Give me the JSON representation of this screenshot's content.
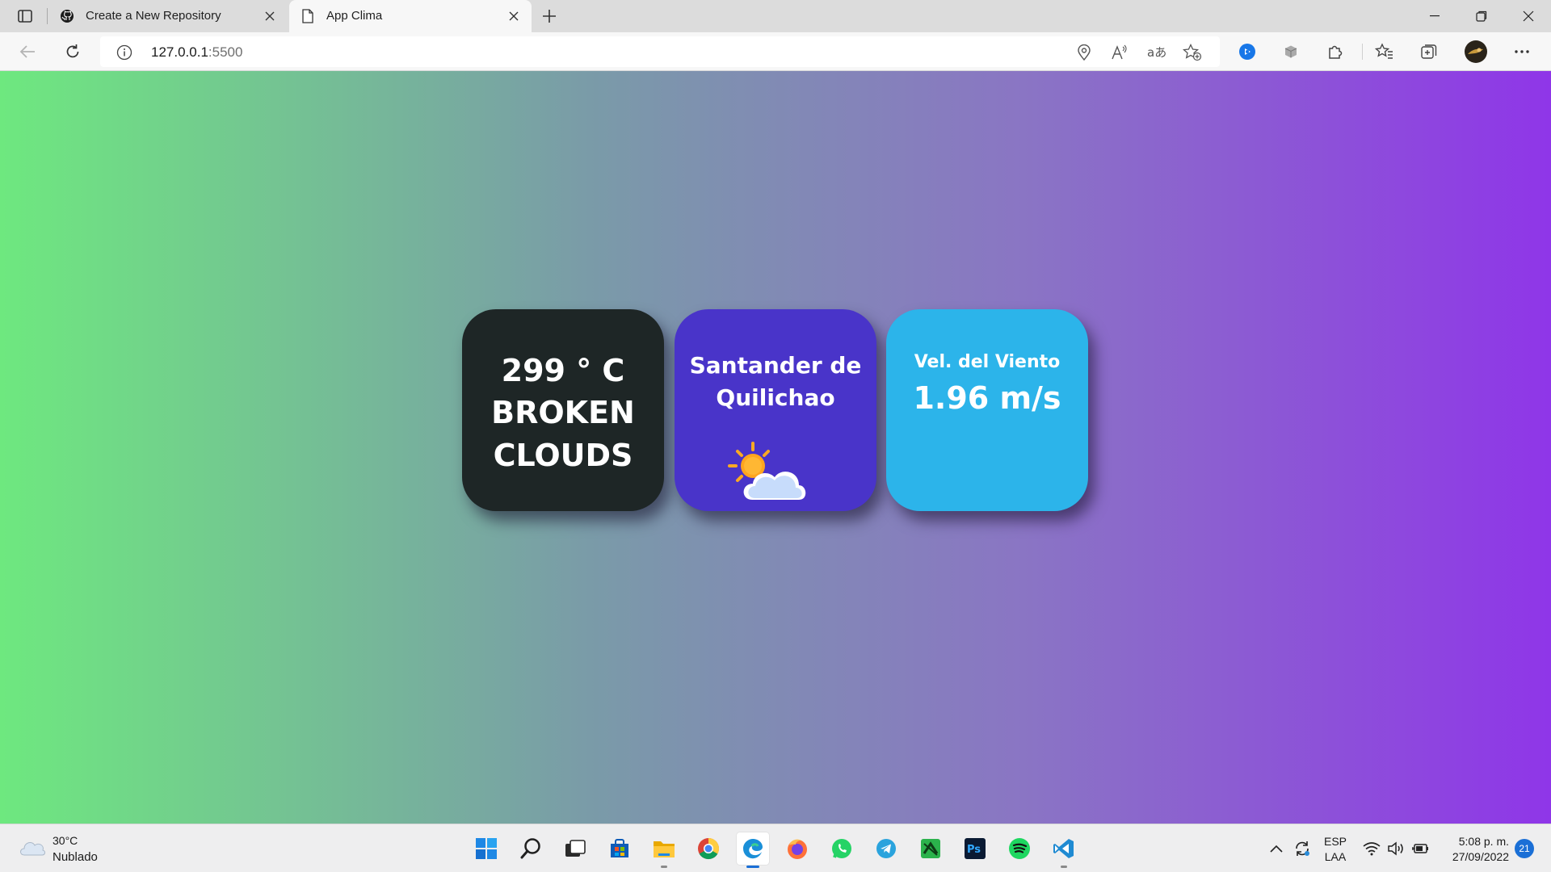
{
  "browser": {
    "tabs": [
      {
        "title": "Create a New Repository",
        "icon": "github-icon",
        "active": false
      },
      {
        "title": "App Clima",
        "icon": "page-icon",
        "active": true
      }
    ],
    "address": {
      "host": "127.0.0.1",
      "port": ":5500"
    }
  },
  "weather_app": {
    "temperature": "299 ° C",
    "condition_line1": "BROKEN",
    "condition_line2": "CLOUDS",
    "city": "Santander de Quilichao",
    "weather_icon": "partly-cloudy-icon",
    "wind_label": "Vel. del Viento",
    "wind_value": "1.96 m/s"
  },
  "taskbar": {
    "weather_temp": "30°C",
    "weather_desc": "Nublado",
    "apps": [
      "windows-start",
      "search",
      "task-view",
      "microsoft-store",
      "file-explorer",
      "chrome",
      "edge",
      "firefox",
      "whatsapp",
      "telegram",
      "spotlight-green-app",
      "photoshop",
      "spotify",
      "vscode"
    ],
    "language_line1": "ESP",
    "language_line2": "LAA",
    "time": "5:08 p. m.",
    "date": "27/09/2022",
    "notifications": "21"
  },
  "colors": {
    "temp_card": "#1e2626",
    "city_card": "#4934c9",
    "wind_card": "#2cb4ea",
    "gradient_left": "#6ee87f",
    "gradient_right": "#8f36e8"
  }
}
